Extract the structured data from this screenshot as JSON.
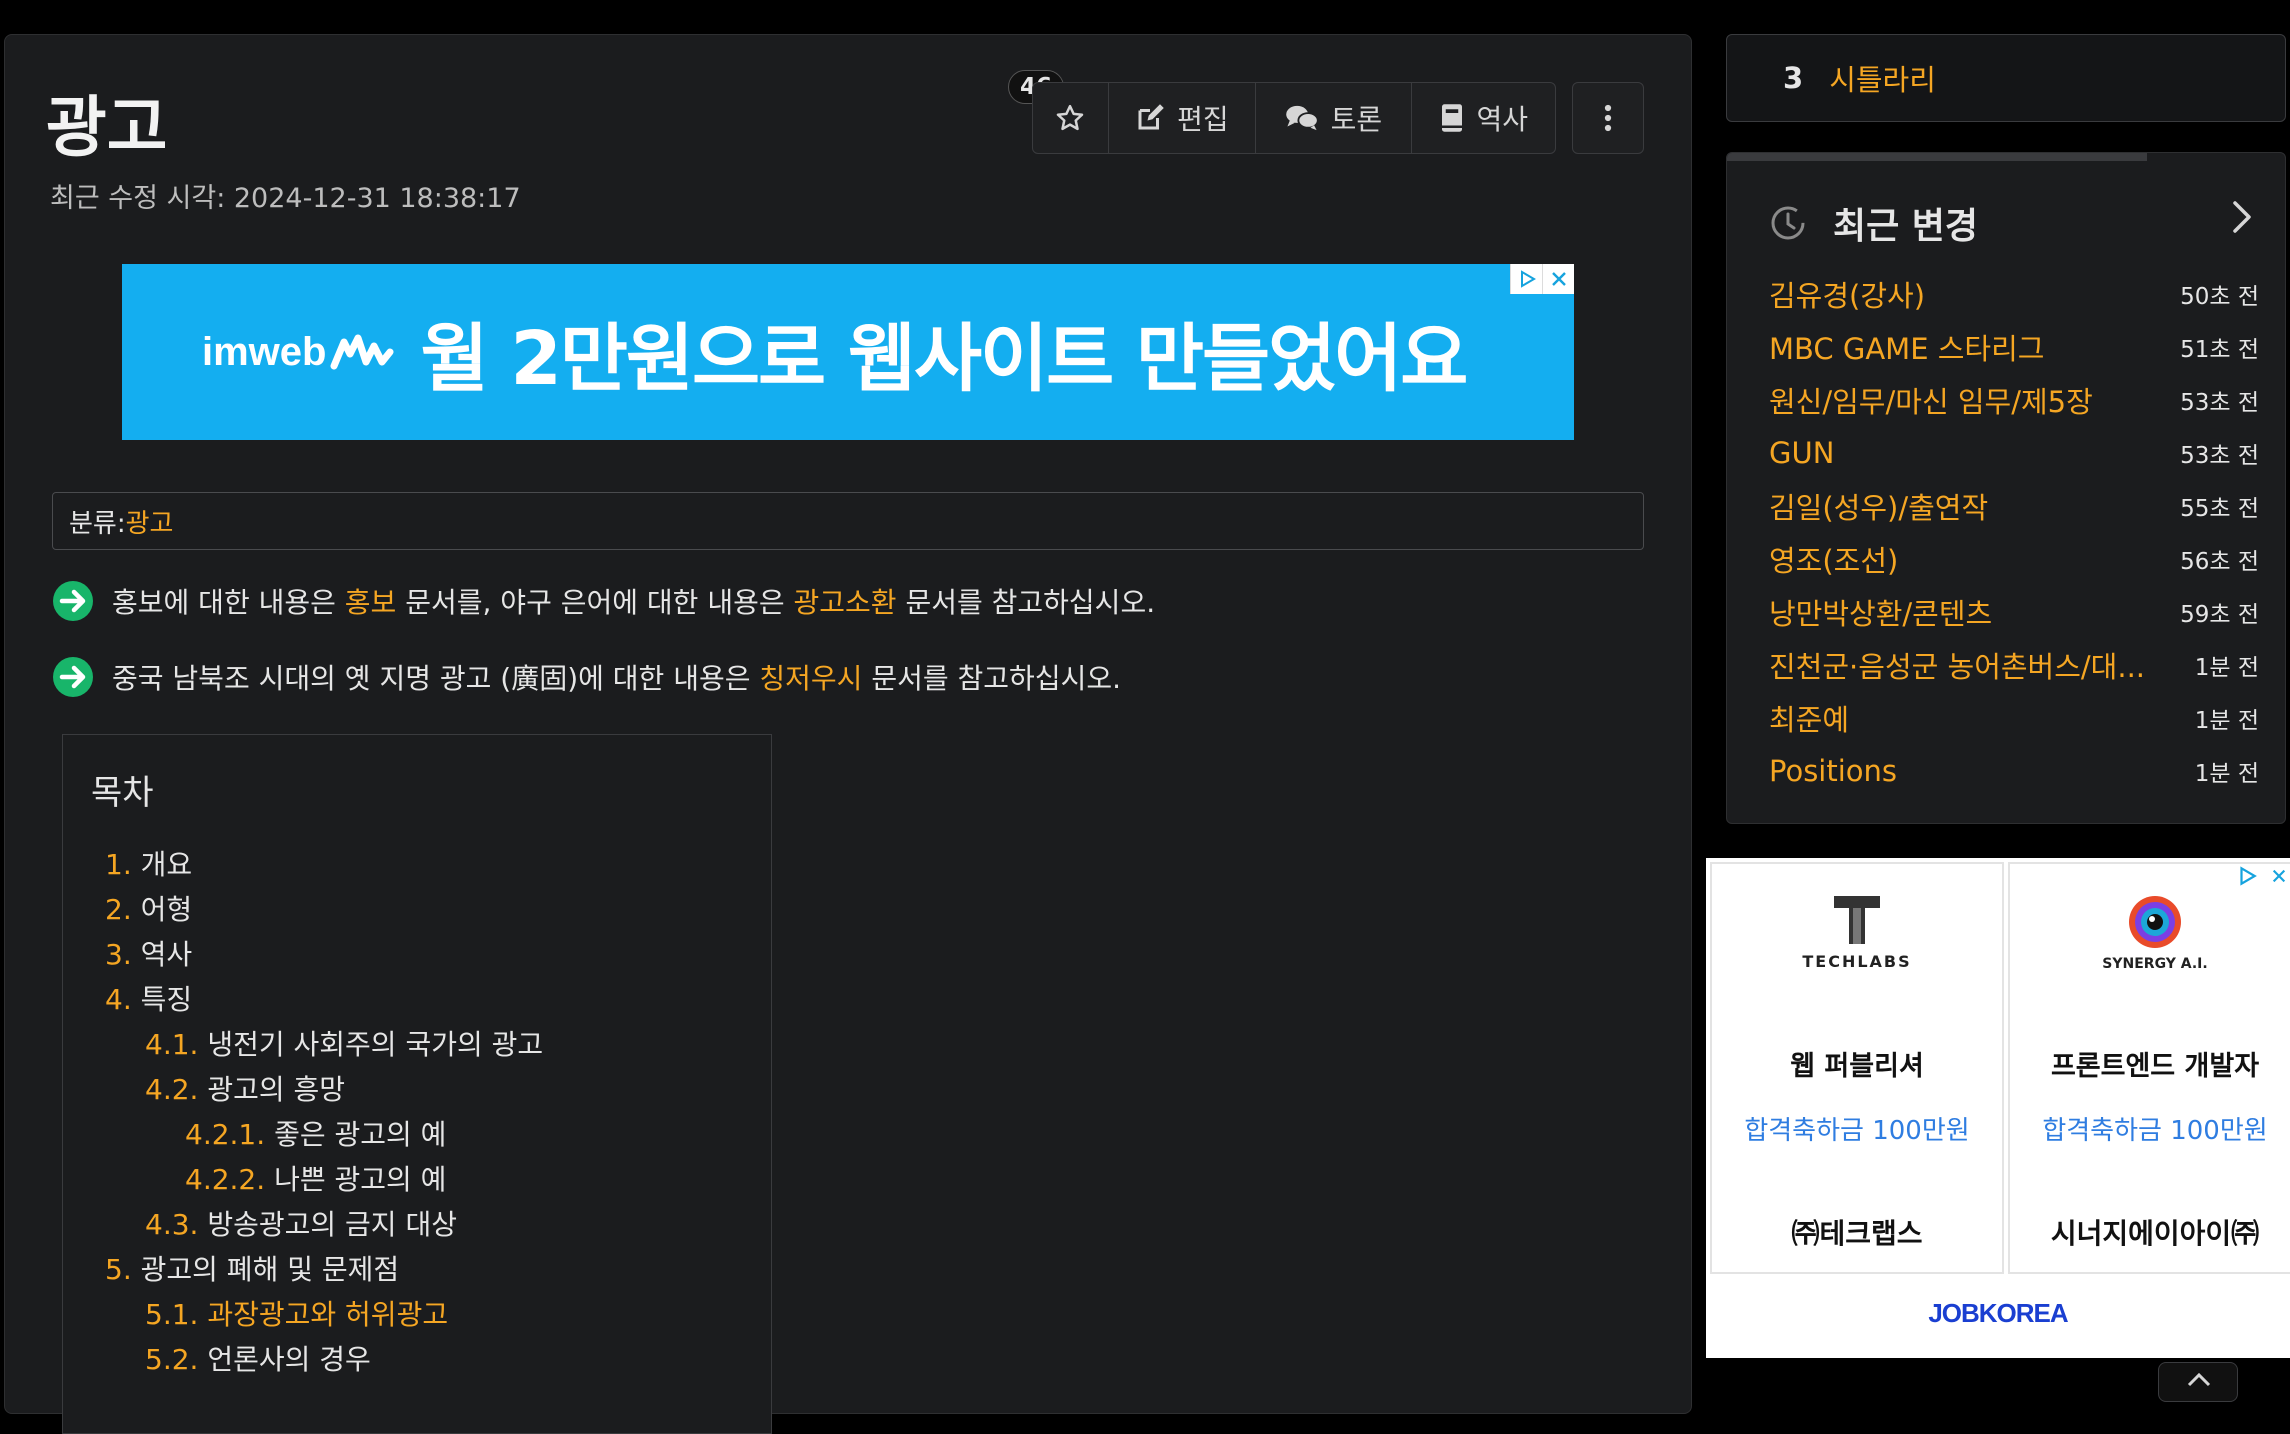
{
  "article": {
    "title": "광고",
    "last_modified": "최근 수정 시각: 2024-12-31 18:38:17",
    "star_count": "46",
    "toolbar": {
      "edit_label": "편집",
      "discussion_label": "토론",
      "history_label": "역사"
    },
    "banner_ad": {
      "logo": "imweb",
      "text": "월 2만원으로 웹사이트 만들었어요"
    },
    "category": {
      "label": "분류:",
      "value": "광고"
    },
    "notices": [
      {
        "before": "홍보에 대한 내용은 ",
        "link1": "홍보",
        "middle": " 문서를, 야구 은어에 대한 내용은 ",
        "link2": "광고소환",
        "after": " 문서를 참고하십시오."
      },
      {
        "before": "중국 남북조 시대의 옛 지명 광고 (廣固)에 대한 내용은 ",
        "link1": "칭저우시",
        "after": " 문서를 참고하십시오."
      }
    ],
    "toc": {
      "title": "목차",
      "items": [
        {
          "num": "1.",
          "label": "개요"
        },
        {
          "num": "2.",
          "label": "어형"
        },
        {
          "num": "3.",
          "label": "역사"
        },
        {
          "num": "4.",
          "label": "특징"
        },
        {
          "num": "4.1.",
          "label": "냉전기 사회주의 국가의 광고"
        },
        {
          "num": "4.2.",
          "label": "광고의 흥망"
        },
        {
          "num": "4.2.1.",
          "label": "좋은 광고의 예"
        },
        {
          "num": "4.2.2.",
          "label": "나쁜 광고의 예"
        },
        {
          "num": "4.3.",
          "label": "방송광고의 금지 대상"
        },
        {
          "num": "5.",
          "label": "광고의 폐해 및 문제점"
        },
        {
          "num": "5.1.",
          "label": "과장광고와 허위광고"
        },
        {
          "num": "5.2.",
          "label": "언론사의 경우"
        }
      ]
    }
  },
  "sidebar": {
    "trending": {
      "rank": "3",
      "label": "시틀라리"
    },
    "recent_changes": {
      "title": "최근 변경",
      "items": [
        {
          "title": "김유경(강사)",
          "time": "50초 전"
        },
        {
          "title": "MBC GAME 스타리그",
          "time": "51초 전"
        },
        {
          "title": "원신/임무/마신 임무/제5장",
          "time": "53초 전"
        },
        {
          "title": "GUN",
          "time": "53초 전"
        },
        {
          "title": "김일(성우)/출연작",
          "time": "55초 전"
        },
        {
          "title": "영조(조선)",
          "time": "56초 전"
        },
        {
          "title": "낭만박상환/콘텐츠",
          "time": "59초 전"
        },
        {
          "title": "진천군·음성군 농어촌버스/대...",
          "time": "1분 전"
        },
        {
          "title": "최준예",
          "time": "1분 전"
        },
        {
          "title": "Positions",
          "time": "1분 전"
        }
      ]
    },
    "job_ad": {
      "cards": [
        {
          "logo": "TECHLABS",
          "position": "웹 퍼블리셔",
          "bonus": "합격축하금 100만원",
          "company": "㈜테크랩스"
        },
        {
          "logo": "SYNERGY A.I.",
          "position": "프론트엔드 개발자",
          "bonus": "합격축하금 100만원",
          "company": "시너지에이아이㈜"
        }
      ],
      "footer": "JOBKOREA"
    }
  },
  "colors": {
    "link": "#f5a623",
    "background": "#1b1c1e",
    "banner": "#14aef0",
    "notice_arrow": "#18b56a"
  }
}
